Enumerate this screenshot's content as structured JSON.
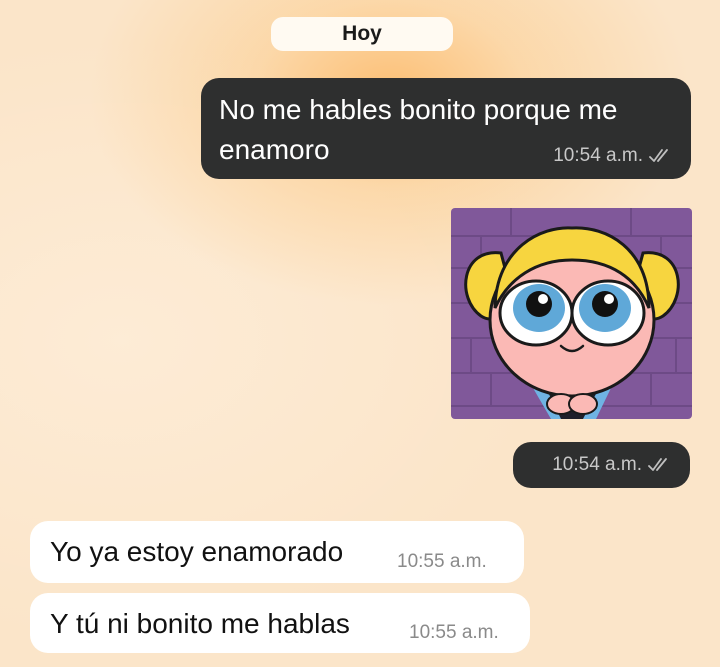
{
  "date_separator": "Hoy",
  "messages": [
    {
      "direction": "outgoing",
      "text": "No me hables bonito porque me enamoro",
      "time": "10:54 a.m.",
      "status": "read"
    },
    {
      "direction": "outgoing",
      "type": "image",
      "image_subject": "cartoon girl with blonde pigtails and big blue eyes on purple brick background",
      "time": "10:54 a.m.",
      "status": "read"
    },
    {
      "direction": "incoming",
      "text": "Yo ya estoy enamorado",
      "time": "10:55 a.m."
    },
    {
      "direction": "incoming",
      "text": "Y tú ni bonito me hablas",
      "time": "10:55 a.m."
    }
  ],
  "colors": {
    "background": "#fbe5c9",
    "outgoing_bubble": "#2e2f2f",
    "incoming_bubble": "#ffffff",
    "read_ticks": "#bfbfbf"
  },
  "icons": {
    "read_status": "double-check-icon"
  }
}
